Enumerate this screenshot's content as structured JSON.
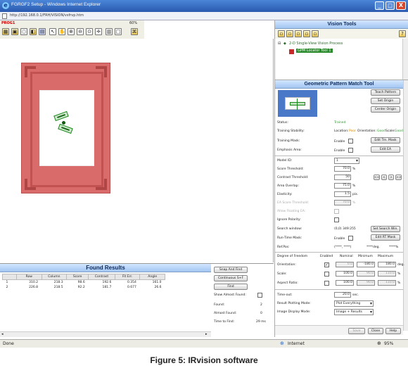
{
  "window": {
    "title": "FGRGF2 Setup - Windows Internet Explorer",
    "address": "http://192.168.0.1/FRH/VISION/vsfrvp.htm"
  },
  "program": {
    "label": "PROG1",
    "zoom": "60%"
  },
  "vision_tools": {
    "title": "Vision Tools",
    "items": [
      {
        "label": "2-D Single-View Vision Process"
      },
      {
        "label": "GPM Locator Tool 1"
      }
    ]
  },
  "gpm": {
    "title": "Geometric Pattern Match Tool",
    "buttons": {
      "teach": "Teach Pattern",
      "set_origin": "Set Origin",
      "center_origin": "Center Origin",
      "edit_trn_mask": "Edit Trn. Mask",
      "edit_ea": "Edit EA",
      "set_search_win": "Set Search Win.",
      "edit_rt_mask": "Edit RT Mask"
    },
    "status_label": "Status:",
    "status_value": "Trained",
    "stability_label": "Training Stability:",
    "stability": {
      "loc_label": "Location:",
      "loc_value": "Poor",
      "ori_label": "Orientation:",
      "ori_value": "Good",
      "scale_label": "Scale:",
      "scale_value": "Good"
    },
    "training_mask_label": "Training Mask:",
    "enable": "Enable",
    "emphasis_label": "Emphasis Area:",
    "model_id_label": "Model ID:",
    "model_id": "1",
    "score_label": "Score Threshold:",
    "score": "70.0",
    "pct": "%",
    "contrast_label": "Contrast Threshold:",
    "contrast": "50",
    "overlap_label": "Area Overlap:",
    "overlap": "75.0",
    "elasticity_label": "Elasticity:",
    "elasticity": "1.5",
    "px": "pix.",
    "ea_score_label": "EA Score Threshold:",
    "ea_score": "70.0",
    "allow_float_label": "Allow Floating EA:",
    "ignore_pol_label": "Ignore Polarity:",
    "search_win_label": "Search window:",
    "search_win": "(0,0) 349:255",
    "rt_mask_label": "Run-Time Mask:",
    "ref_pos_label": "Ref.Pos:",
    "ref_pos": "(****, ****)",
    "ref_deg": "****deg.",
    "ref_pct": "****%",
    "stepper": [
      "<<",
      "<",
      ">",
      ">>"
    ],
    "dof": {
      "headers": [
        "Degree of Freedom",
        "Enabled",
        "Nominal",
        "Minimum",
        "Maximum"
      ],
      "rows": [
        {
          "label": "Orientation:",
          "checked": true,
          "nominal": "0.0",
          "min": "-180.0",
          "max": "180.0",
          "unit": "deg."
        },
        {
          "label": "Scale:",
          "checked": false,
          "nominal": "100.0",
          "min": "90.0",
          "max": "110.0",
          "unit": "%"
        },
        {
          "label": "Aspect Ratio:",
          "checked": false,
          "nominal": "100.0",
          "min": "90.0",
          "max": "110.0",
          "unit": "%"
        }
      ]
    },
    "timeout_label": "Time-out:",
    "timeout": "20.0",
    "sec": "sec.",
    "result_mode_label": "Result Plotting Mode:",
    "result_mode": "Plot Everything",
    "image_mode_label": "Image Display Mode:",
    "image_mode": "Image + Results",
    "footer": {
      "save": "Save",
      "close": "Close",
      "help": "Help"
    }
  },
  "found_results": {
    "title": "Found Results",
    "headers": [
      "",
      "Row",
      "Column",
      "Score",
      "Contrast",
      "Fit Err.",
      "Angle"
    ],
    "rows": [
      [
        "1",
        "310.2",
        "218.3",
        "98.6",
        "192.6",
        "0.354",
        "161.0"
      ],
      [
        "2",
        "226.8",
        "218.5",
        "92.2",
        "181.7",
        "0.677",
        "26.6"
      ]
    ],
    "buttons": {
      "snap_find": "Snap And Find",
      "continuous": "Continuous S+F",
      "find": "Find"
    },
    "show_almost_label": "Show Almost Found:",
    "found_label": "Found:",
    "found": "2",
    "almost_label": "Almost Found:",
    "almost": "0",
    "time_label": "Time to Find:",
    "time": "29 ms"
  },
  "statusbar": {
    "done": "Done",
    "zone": "Internet",
    "zoom": "95%"
  },
  "caption": "Figure 5: IRvision software",
  "colors": {
    "overlay": "#d96b6b",
    "title_blue": "#1f4f9c",
    "trained": "#2e9b2e",
    "poor": "#e08a00"
  }
}
